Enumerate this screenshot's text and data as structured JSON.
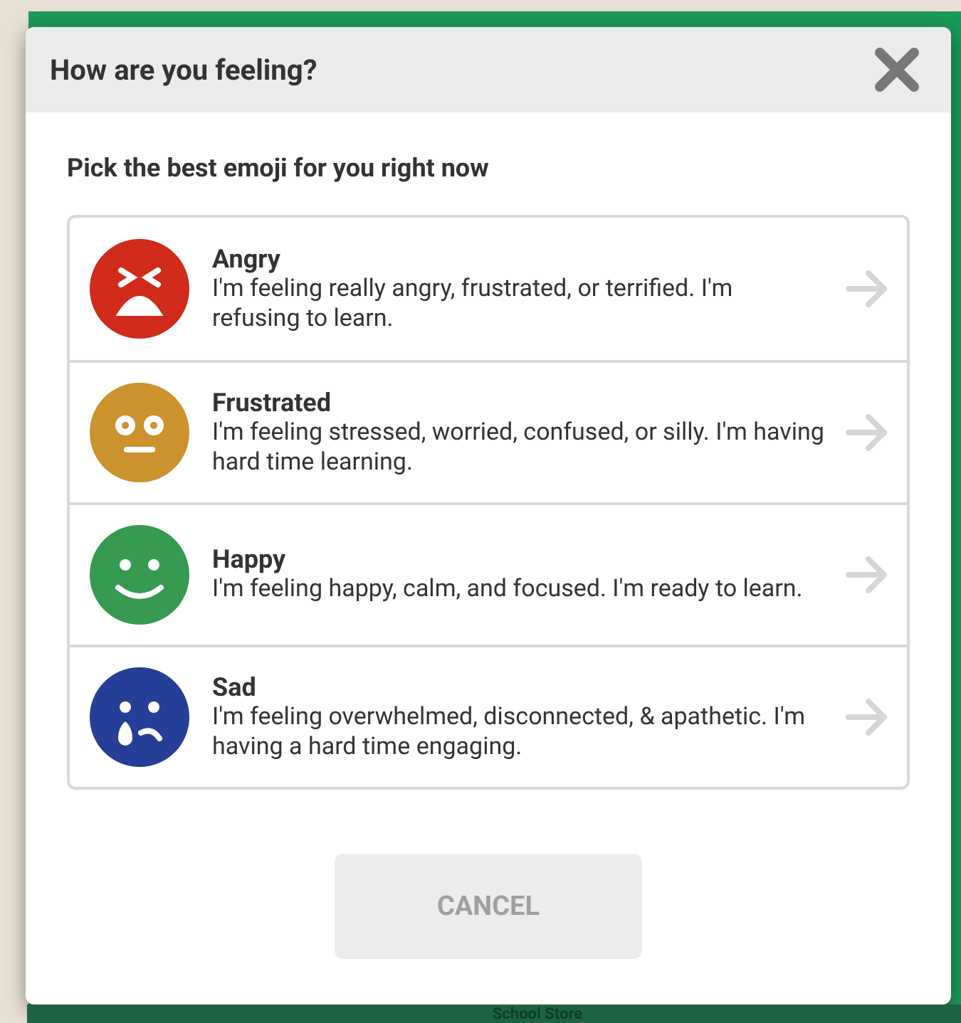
{
  "dialog": {
    "title": "How are you feeling?",
    "prompt": "Pick the best emoji for you right now"
  },
  "moods": [
    {
      "kind": "angry",
      "color": "#d02a1a",
      "name": "Angry",
      "description": "I'm feeling really angry, frustrated, or terrified. I'm refusing to learn."
    },
    {
      "kind": "frustrated",
      "color": "#cc922e",
      "name": "Frustrated",
      "description": "I'm feeling stressed, worried, confused, or silly. I'm having hard time learning."
    },
    {
      "kind": "happy",
      "color": "#359a4f",
      "name": "Happy",
      "description": "I'm feeling happy, calm, and focused. I'm ready to learn."
    },
    {
      "kind": "sad",
      "color": "#263f96",
      "name": "Sad",
      "description": "I'm feeling overwhelmed, disconnected, & apathetic. I'm having a hard time engaging."
    }
  ],
  "buttons": {
    "cancel": "CANCEL"
  },
  "background": {
    "label": "School Store"
  }
}
